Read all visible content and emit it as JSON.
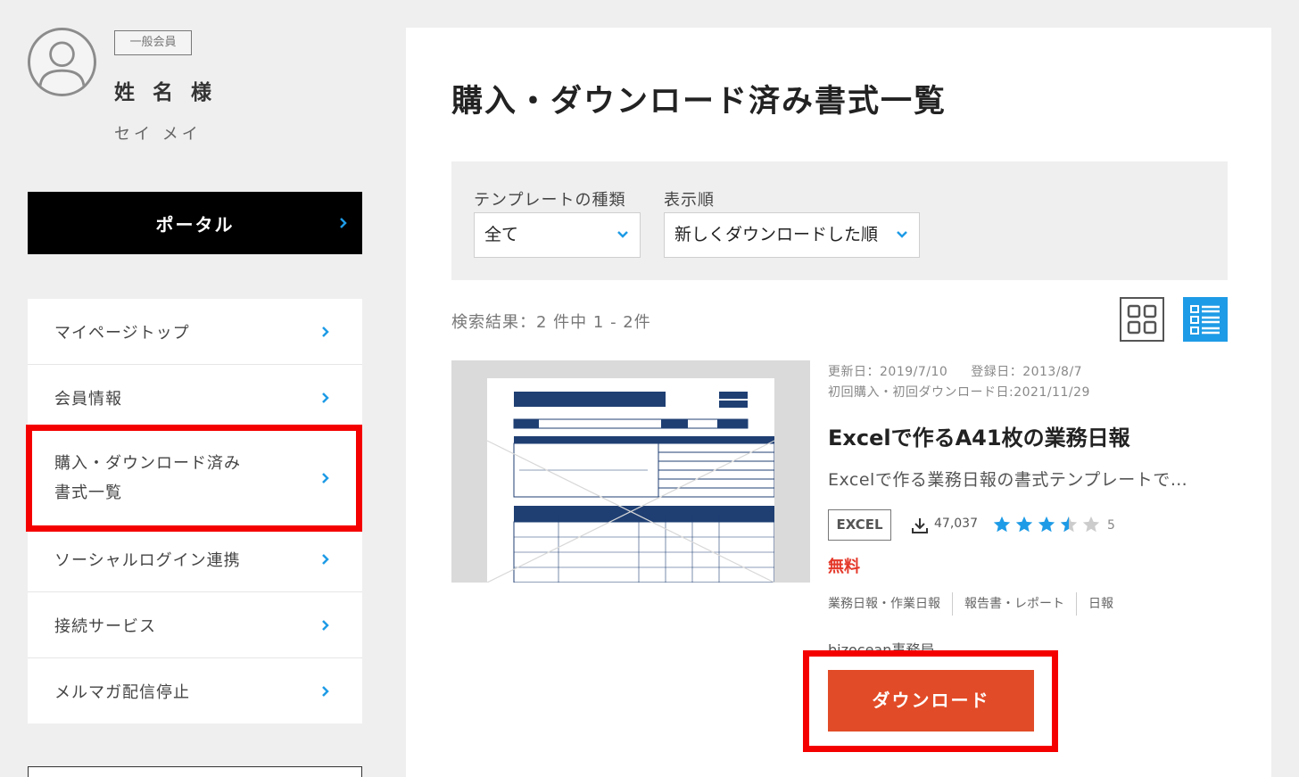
{
  "sidebar": {
    "member_badge": "一般会員",
    "user_name": "姓 名 様",
    "user_kana": "セイ メイ",
    "portal_label": "ポータル",
    "menu": [
      {
        "label": "マイページトップ"
      },
      {
        "label": "会員情報"
      },
      {
        "label_line1": "購入・ダウンロード済み",
        "label_line2": "書式一覧"
      },
      {
        "label": "ソーシャルログイン連携"
      },
      {
        "label": "接続サービス"
      },
      {
        "label": "メルマガ配信停止"
      }
    ]
  },
  "main": {
    "title": "購入・ダウンロード済み書式一覧",
    "filters": {
      "type_label": "テンプレートの種類",
      "type_value": "全て",
      "order_label": "表示順",
      "order_value": "新しくダウンロードした順"
    },
    "result_count": "検索結果：2 件中 1 - 2件",
    "item": {
      "updated": "更新日：2019/7/10",
      "registered": "登録日：2013/8/7",
      "first_download": "初回購入・初回ダウンロード日:2021/11/29",
      "title": "Excelで作るA41枚の業務日報",
      "description": "Excelで作る業務日報の書式テンプレートで…",
      "format": "EXCEL",
      "downloads": "47,037",
      "rating": 3.5,
      "rating_count": "5",
      "price": "無料",
      "tags": [
        "業務日報・作業日報",
        "報告書・レポート",
        "日報"
      ],
      "author": "bizocean事務局",
      "download_label": "ダウンロード"
    }
  },
  "colors": {
    "accent_blue": "#1e9be6",
    "download_orange": "#e24b27",
    "highlight_red": "#f40000",
    "price_red": "#e4382a",
    "star_blue": "#1e9be6"
  }
}
